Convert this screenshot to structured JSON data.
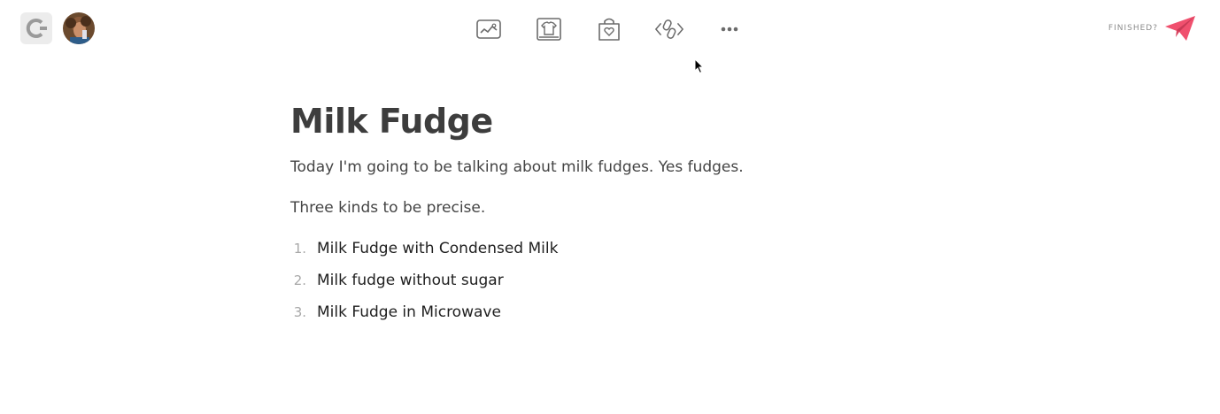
{
  "topbar": {
    "logo_icon": "medium-logo-icon",
    "avatar_icon": "user-avatar",
    "tools": [
      {
        "icon": "image-icon"
      },
      {
        "icon": "shirt-icon"
      },
      {
        "icon": "shopping-bag-heart-icon"
      },
      {
        "icon": "link-code-icon"
      },
      {
        "icon": "more-dots-icon"
      }
    ],
    "finished_label": "FINISHED?",
    "send_icon": "paper-plane-icon",
    "accent_color": "#f0506e"
  },
  "document": {
    "title": "Milk Fudge",
    "paragraphs": [
      "Today I'm going to be talking about milk fudges. Yes fudges.",
      "Three kinds to be precise."
    ],
    "list": [
      {
        "num": "1.",
        "text": "Milk Fudge with Condensed Milk"
      },
      {
        "num": "2.",
        "text": "Milk fudge without sugar"
      },
      {
        "num": "3.",
        "text": "Milk Fudge in Microwave"
      }
    ]
  }
}
